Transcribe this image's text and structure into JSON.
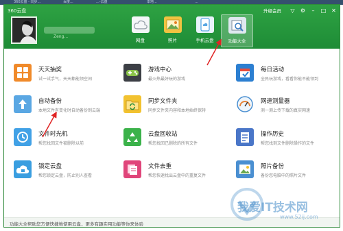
{
  "app": {
    "title": "360云盘"
  },
  "user": {
    "id_text": "Zeng..."
  },
  "header": {
    "upgrade_label": "升级会员",
    "nav": [
      {
        "label": "网盘",
        "icon": "cloud-disk-icon"
      },
      {
        "label": "照片",
        "icon": "photo-icon"
      },
      {
        "label": "手机云盘",
        "icon": "phone-cloud-icon"
      },
      {
        "label": "功能大全",
        "icon": "all-features-icon"
      }
    ],
    "controls": [
      "shirt-icon",
      "gear-icon",
      "minimize-icon",
      "maximize-icon",
      "close-icon"
    ]
  },
  "features": [
    {
      "title": "天天抽奖",
      "desc": "试一试手气，天天都能领空间",
      "icon": "lottery-icon",
      "color": "#f08a2a"
    },
    {
      "title": "游戏中心",
      "desc": "最火热最好玩的游戏",
      "icon": "gamepad-icon",
      "color": "#3c3f45"
    },
    {
      "title": "每日活动",
      "desc": "全民玩游戏，看看你能不能领到",
      "icon": "daily-activity-icon",
      "color": "#2c7fd1"
    },
    {
      "title": "自动备份",
      "desc": "本地文件有变化时自动备份到云端",
      "icon": "auto-backup-icon",
      "color": "#5aa7e3"
    },
    {
      "title": "同步文件夹",
      "desc": "同步文件夹内容和本地始终保持",
      "icon": "sync-folder-icon",
      "color": "#f2c230"
    },
    {
      "title": "网速测量器",
      "desc": "测一测上传下载的真实网速",
      "icon": "speed-test-icon",
      "color": "#e8863a"
    },
    {
      "title": "文件时光机",
      "desc": "帮您找回文件被删除以前",
      "icon": "time-machine-icon",
      "color": "#41a1e6"
    },
    {
      "title": "云盘回收站",
      "desc": "帮您找回已删除的所有文件",
      "icon": "recycle-bin-icon",
      "color": "#3bb24a"
    },
    {
      "title": "操作历史",
      "desc": "帮您找到文件删除操作的文件",
      "icon": "history-icon",
      "color": "#4a76c8"
    },
    {
      "title": "锁定云盘",
      "desc": "帮您锁定云盘，防止别人查看",
      "icon": "lock-cloud-icon",
      "color": "#3a9ee0"
    },
    {
      "title": "文件去重",
      "desc": "帮您快速找出云盘中的重复文件",
      "icon": "dedupe-icon",
      "color": "#e0457a"
    },
    {
      "title": "照片备份",
      "desc": "备份您电脑中的照片文件",
      "icon": "photo-backup-icon",
      "color": "#4a8fd1"
    }
  ],
  "status": {
    "text": "功能大全帮助您方便快捷地使用云盘，更多有趣实用功能等你来体验"
  },
  "watermark": {
    "main": "我爱IT技术网",
    "url": "www.52ij.com"
  },
  "bg_tabs": [
    "360云盘 - 同步...",
    "百度...",
    "...-云盘",
    "本地...",
    "..."
  ]
}
